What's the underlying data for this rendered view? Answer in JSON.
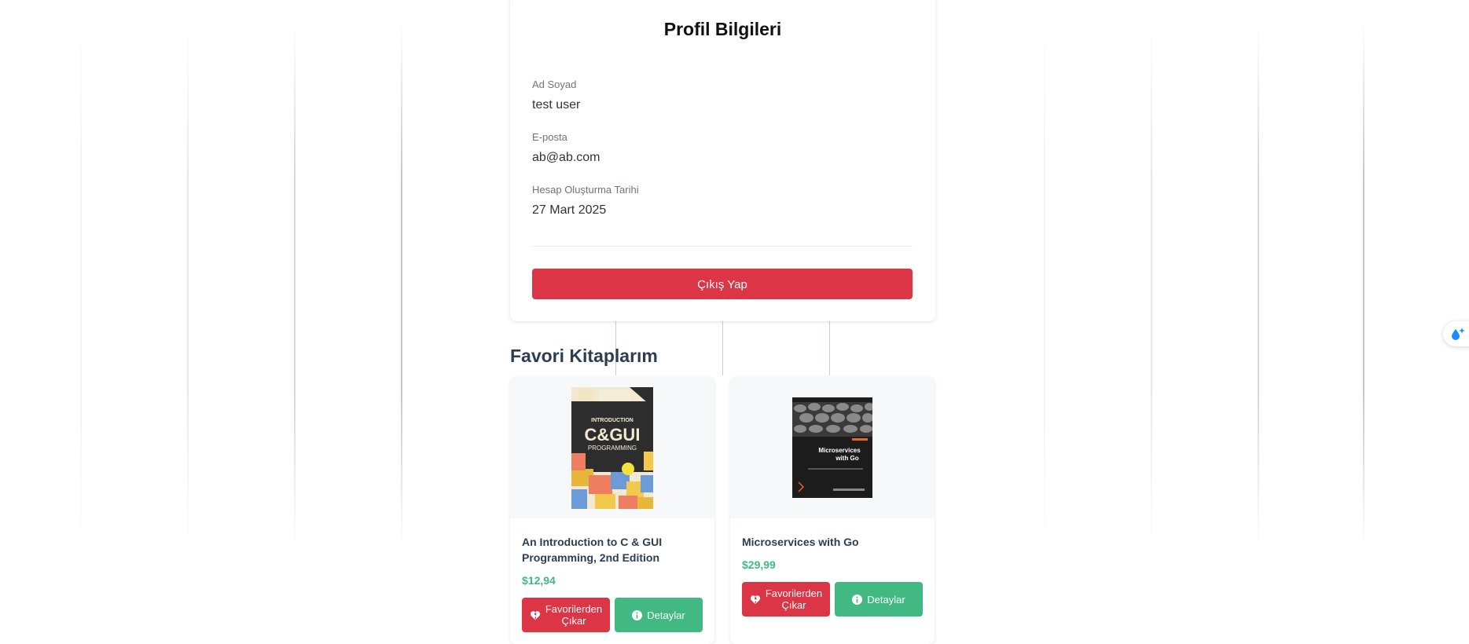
{
  "profile": {
    "title": "Profil Bilgileri",
    "name_label": "Ad Soyad",
    "name_value": "test user",
    "email_label": "E-posta",
    "email_value": "ab@ab.com",
    "created_label": "Hesap Oluşturma Tarihi",
    "created_value": "27 Mart 2025",
    "logout_label": "Çıkış Yap"
  },
  "favorites": {
    "title": "Favori Kitaplarım",
    "books": [
      {
        "name": "An Introduction to C & GUI Programming, 2nd Edition",
        "price": "$12,94",
        "cover_lines": [
          "AN INTRODUCTION TO",
          "C&GUI",
          "PROGRAMMING"
        ],
        "remove_label_1": "Favorilerden",
        "remove_label_2": "Çıkar",
        "detail_label": "Detaylar"
      },
      {
        "name": "Microservices with Go",
        "price": "$29,99",
        "cover_lines": [
          "Microservices",
          "with Go"
        ],
        "remove_label_1": "Favorilerden",
        "remove_label_2": "Çıkar",
        "detail_label": "Detaylar"
      }
    ]
  },
  "colors": {
    "danger": "#dc3545",
    "success": "#42b883",
    "heading": "#2c3e50"
  },
  "icons": {
    "remove": "broken-heart-icon",
    "detail": "info-icon",
    "widget": "water-drop-sparkle-icon"
  }
}
